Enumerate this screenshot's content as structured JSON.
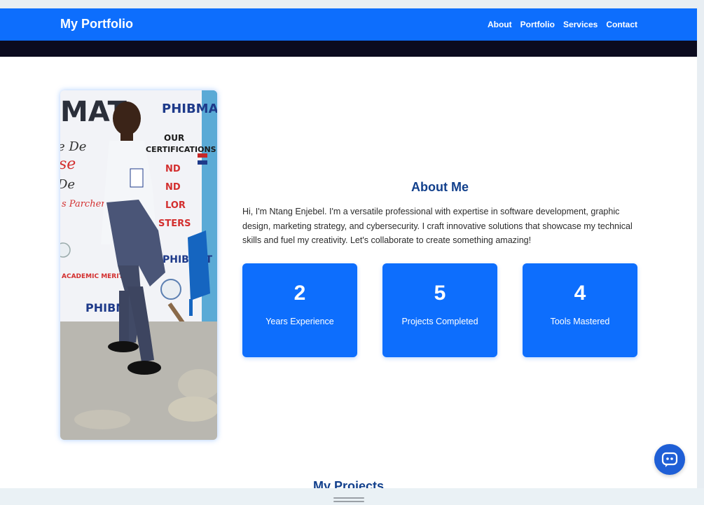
{
  "navbar": {
    "brand": "My Portfolio",
    "links": [
      "About",
      "Portfolio",
      "Services",
      "Contact"
    ]
  },
  "about": {
    "title": "About Me",
    "text": "Hi, I'm Ntang Enjebel. I'm a versatile professional with expertise in software development, graphic design, marketing strategy, and cybersecurity. I craft innovative solutions that showcase my technical skills and fuel my creativity. Let's collaborate to create something amazing!",
    "stats": [
      {
        "value": "2",
        "label": "Years Experience"
      },
      {
        "value": "5",
        "label": "Projects Completed"
      },
      {
        "value": "4",
        "label": "Tools Mastered"
      }
    ]
  },
  "projects": {
    "title": "My Projects"
  },
  "banner_text": [
    "PHIBMAT",
    "OUR",
    "CERTIFICATIONS",
    "PHIBMAT",
    "PHIBMAT",
    "ACADEMIC MERIT"
  ],
  "colors": {
    "primary": "#0d6efd",
    "heading": "#12408c",
    "dark_band": "#0b0b1f",
    "chat_button": "#1f5fd6"
  },
  "icons": {
    "chat": "chat-bubble-icon"
  }
}
